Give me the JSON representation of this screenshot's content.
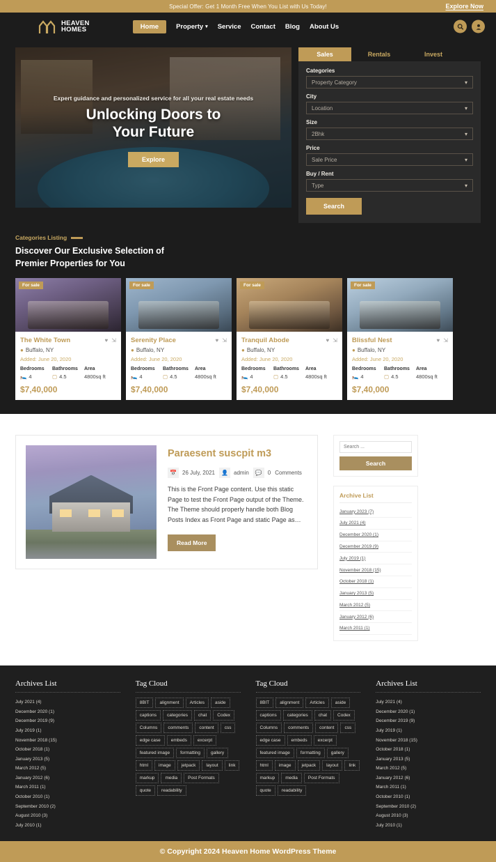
{
  "topbar": {
    "offer_text": "Special Offer: Get 1 Month Free When You List with Us Today!",
    "explore_now": "Explore Now"
  },
  "header": {
    "brand_line1": "HEAVEN",
    "brand_line2": "HOMES",
    "nav": [
      {
        "label": "Home",
        "active": true,
        "caret": ""
      },
      {
        "label": "Property",
        "active": false,
        "caret": "⌄"
      },
      {
        "label": "Service",
        "active": false,
        "caret": ""
      },
      {
        "label": "Contact",
        "active": false,
        "caret": ""
      },
      {
        "label": "Blog",
        "active": false,
        "caret": ""
      },
      {
        "label": "About Us",
        "active": false,
        "caret": ""
      }
    ]
  },
  "hero": {
    "subtitle": "Expert guidance and personalized service for all your real estate needs",
    "title_line1": "Unlocking Doors to",
    "title_line2": "Your Future",
    "button": "Explore"
  },
  "search_panel": {
    "tabs": [
      {
        "label": "Sales",
        "active": true
      },
      {
        "label": "Rentals",
        "active": false
      },
      {
        "label": "Invest",
        "active": false
      }
    ],
    "fields": [
      {
        "label": "Categories",
        "value": "Property Category"
      },
      {
        "label": "City",
        "value": "Location"
      },
      {
        "label": "Size",
        "value": "2Bhk"
      },
      {
        "label": "Price",
        "value": "Sale Price"
      },
      {
        "label": "Buy / Rent",
        "value": "Type"
      }
    ],
    "search_button": "Search"
  },
  "listing": {
    "eyebrow": "Categories Listing",
    "title_line1": "Discover Our Exclusive Selection of",
    "title_line2": "Premier Properties for You",
    "badge": "For sale",
    "labels": {
      "added": "Added:",
      "bedrooms": "Bedrooms",
      "bathrooms": "Bathrooms",
      "area": "Area"
    },
    "cards": [
      {
        "title": "The White Town",
        "location": "Buffalo, NY",
        "added_date": "June 20, 2020",
        "bedrooms": "4",
        "bathrooms": "4.5",
        "area": "4800sq ft",
        "price": "$7,40,000"
      },
      {
        "title": "Serenity Place",
        "location": "Buffalo, NY",
        "added_date": "June 20, 2020",
        "bedrooms": "4",
        "bathrooms": "4.5",
        "area": "4800sq ft",
        "price": "$7,40,000"
      },
      {
        "title": "Tranquil Abode",
        "location": "Buffalo, NY",
        "added_date": "June 20, 2020",
        "bedrooms": "4",
        "bathrooms": "4.5",
        "area": "4800sq ft",
        "price": "$7,40,000"
      },
      {
        "title": "Blissful Nest",
        "location": "Buffalo, NY",
        "added_date": "June 20, 2020",
        "bedrooms": "4",
        "bathrooms": "4.5",
        "area": "4800sq ft",
        "price": "$7,40,000"
      }
    ]
  },
  "blog": {
    "title": "Paraesent suscpit m3",
    "date": "26 July, 2021",
    "author": "admin",
    "comment_count": "0",
    "comments_label": "Comments",
    "excerpt": "This is the Front Page content. Use this static Page to test the Front Page output of the Theme. The Theme should properly handle both Blog Posts Index as Front Page and static Page as…",
    "read_more": "Read More"
  },
  "sidebar": {
    "search_placeholder": "Search ...",
    "search_button": "Search",
    "archive_title": "Archive List",
    "archives": [
      "January 2023 (7)",
      "July 2021 (4)",
      "December 2020 (1)",
      "December 2019 (9)",
      "July 2019 (1)",
      "November 2018 (15)",
      "October 2018 (1)",
      "January 2013 (5)",
      "March 2012 (5)",
      "January 2012 (6)",
      "March 2011 (1)"
    ]
  },
  "footer": {
    "columns": [
      {
        "type": "archives",
        "title": "Archives List"
      },
      {
        "type": "tags",
        "title": "Tag Cloud"
      },
      {
        "type": "tags",
        "title": "Tag Cloud"
      },
      {
        "type": "archives",
        "title": "Archives List"
      }
    ],
    "archives": [
      "July 2021 (4)",
      "December 2020 (1)",
      "December 2019 (9)",
      "July 2019 (1)",
      "November 2018 (15)",
      "October 2018 (1)",
      "January 2013 (5)",
      "March 2012 (5)",
      "January 2012 (6)",
      "March 2011 (1)",
      "October 2010 (1)",
      "September 2010 (2)",
      "August 2010 (3)",
      "July 2010 (1)"
    ],
    "tags": [
      "8BIT",
      "alignment",
      "Articles",
      "aside",
      "captions",
      "categories",
      "chat",
      "Codex",
      "Columns",
      "comments",
      "content",
      "css",
      "edge case",
      "embeds",
      "excerpt",
      "featured image",
      "formatting",
      "gallery",
      "html",
      "image",
      "jetpack",
      "layout",
      "link",
      "markup",
      "media",
      "Post Formats",
      "quote",
      "readability"
    ]
  },
  "copyright": "© Copyright 2024 Heaven Home  WordPress Theme",
  "colors": {
    "gold": "#bf9b57",
    "gold_light": "#c9a961",
    "dark": "#1c1c1c",
    "footer_dark": "#1f1f1f"
  }
}
